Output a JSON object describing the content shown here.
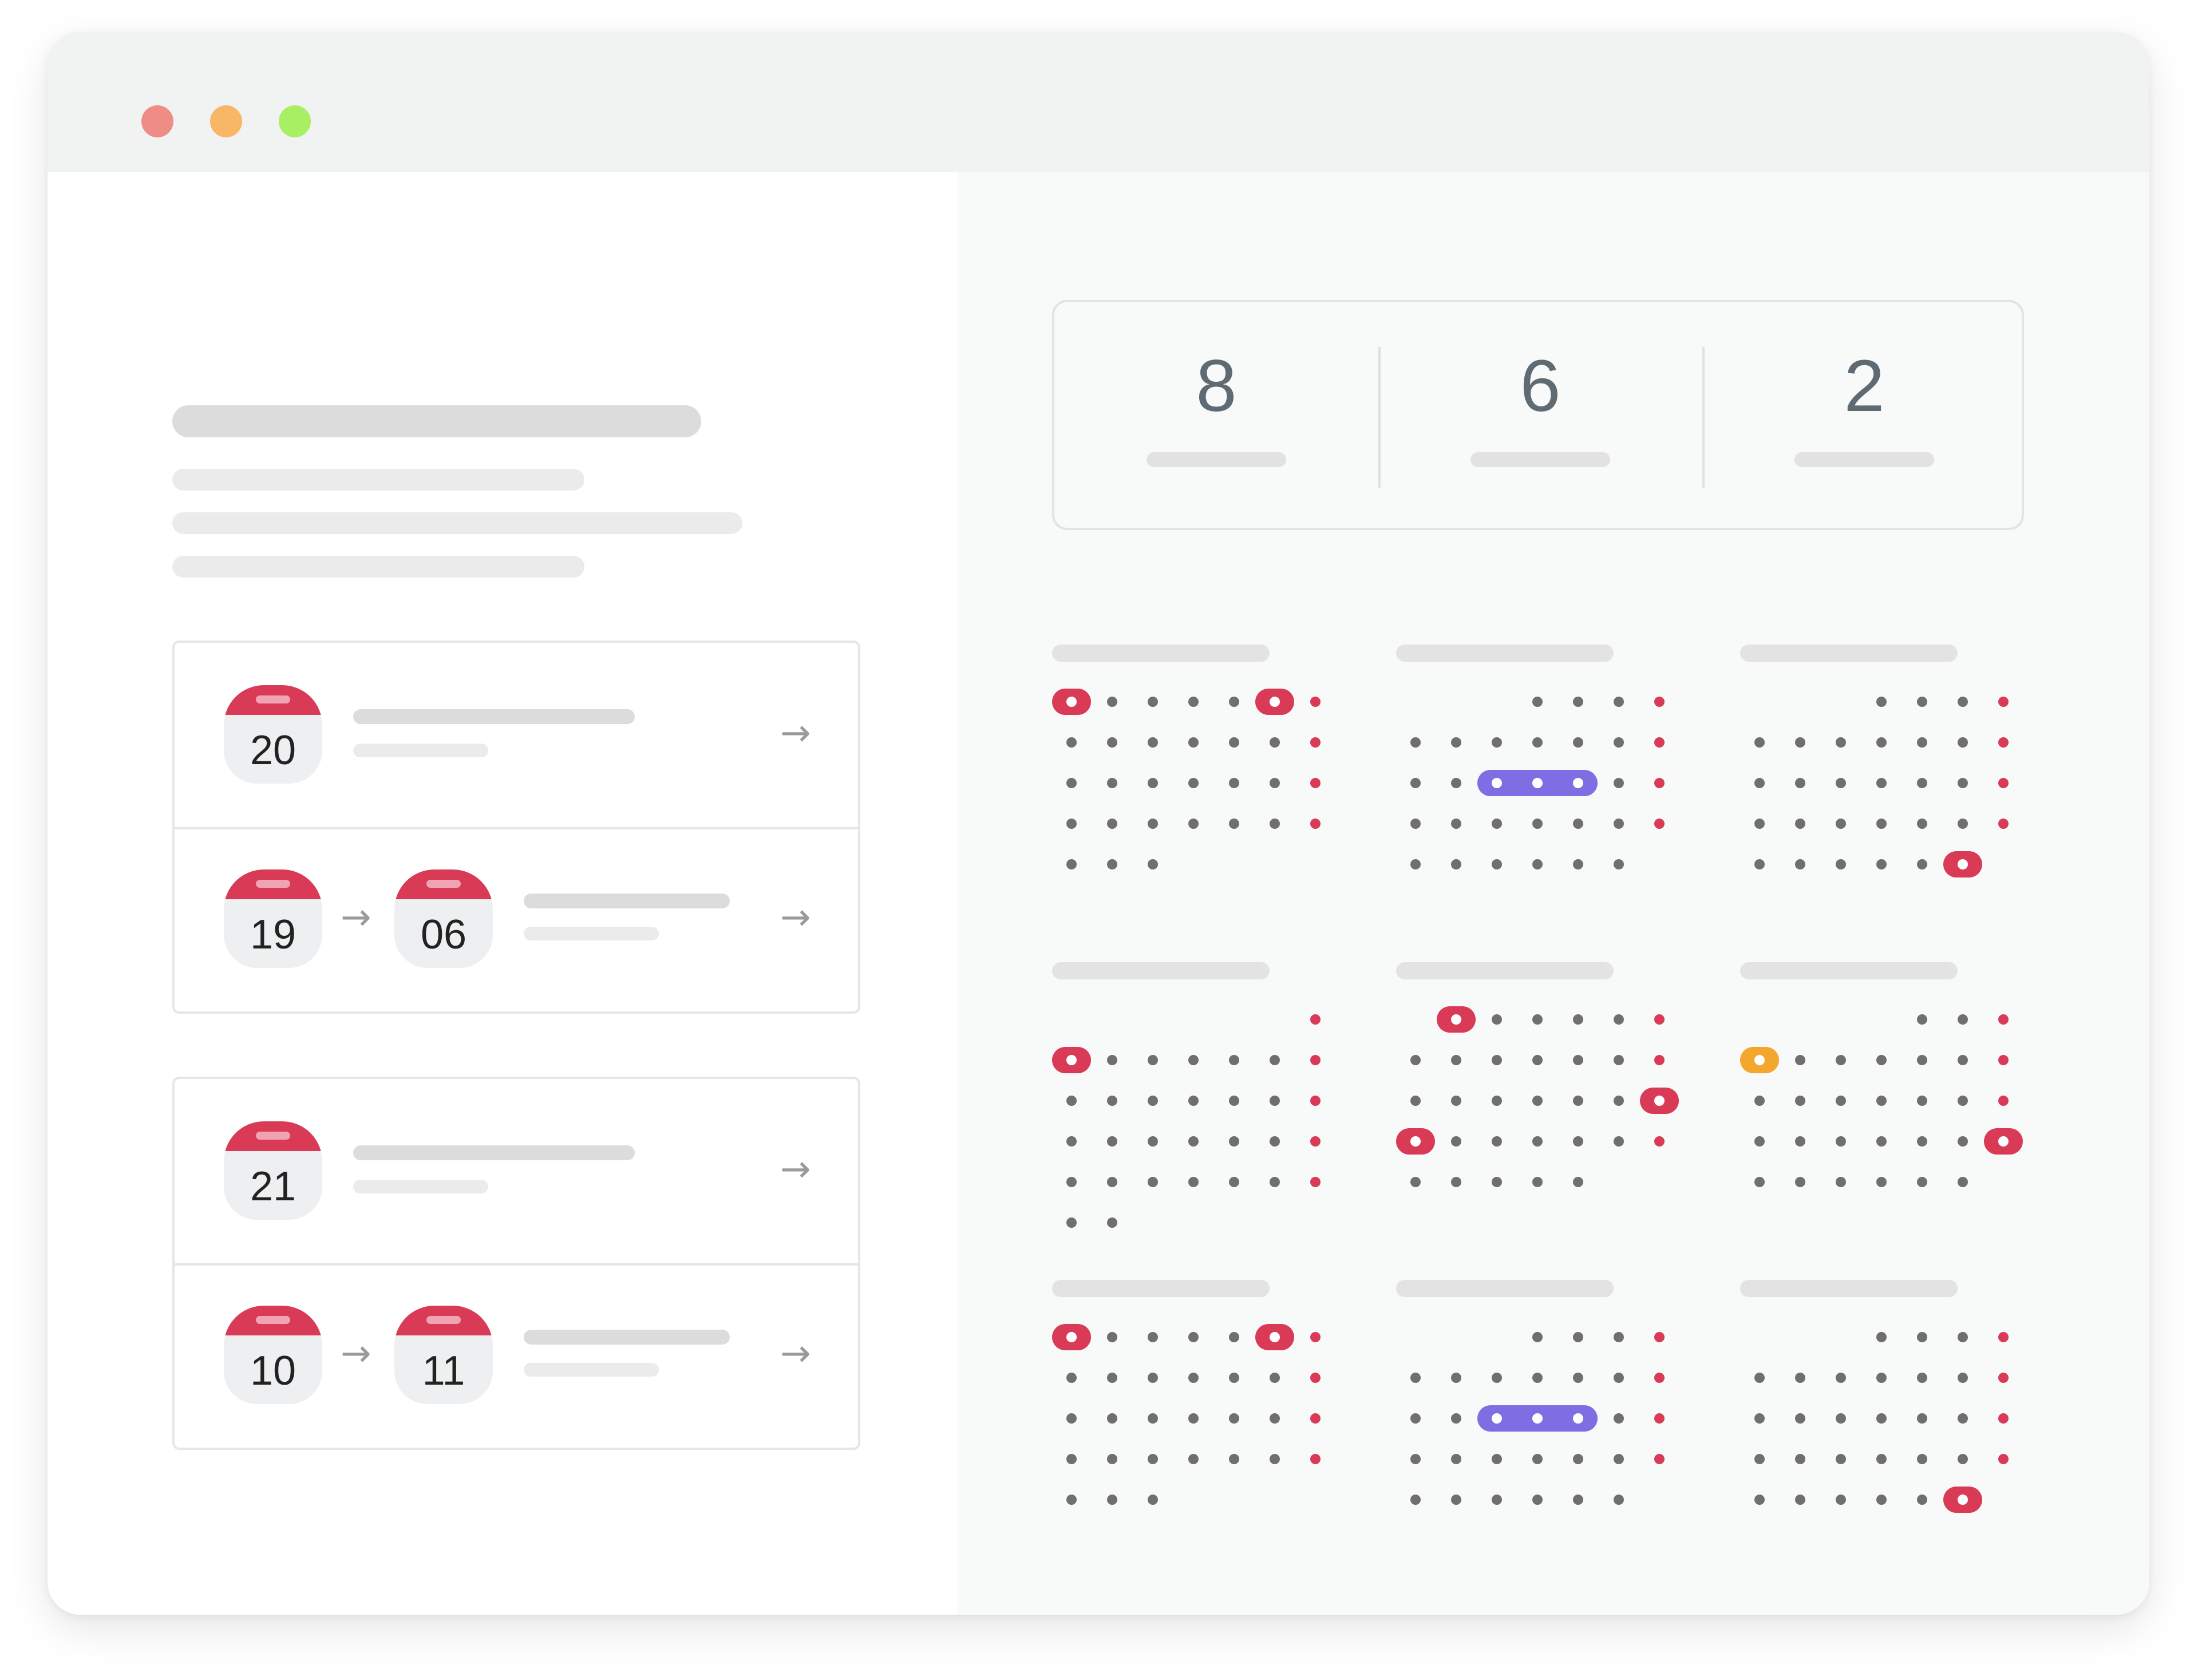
{
  "window": {
    "controls": [
      "close",
      "minimize",
      "maximize"
    ],
    "colors": {
      "close": "#f08c86",
      "minimize": "#f8b667",
      "maximize": "#a9ef63",
      "accent": "#d93b56",
      "range": "#7d6ee3",
      "warning": "#f3a72e"
    }
  },
  "events": [
    {
      "rows": [
        {
          "from": "20",
          "arrow_icon": "arrow-right-icon"
        },
        {
          "from": "19",
          "to": "06",
          "arrow_icon": "arrow-right-icon"
        }
      ]
    },
    {
      "rows": [
        {
          "from": "21",
          "arrow_icon": "arrow-right-icon"
        },
        {
          "from": "10",
          "to": "11",
          "arrow_icon": "arrow-right-icon"
        }
      ]
    }
  ],
  "stats": [
    {
      "value": "8"
    },
    {
      "value": "6"
    },
    {
      "value": "2"
    }
  ],
  "arrow_glyph": "→"
}
